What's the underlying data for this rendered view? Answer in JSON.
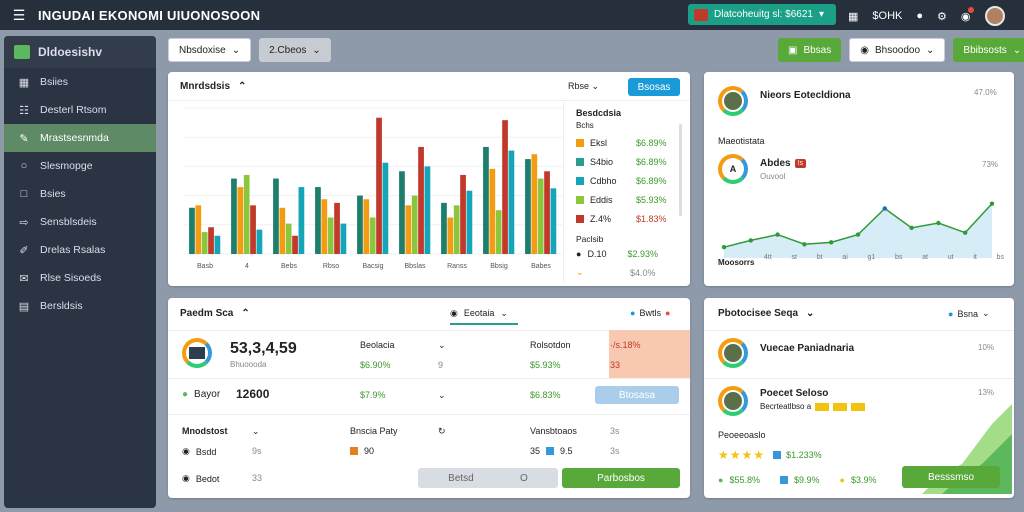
{
  "topbar": {
    "title": "INGUDAI EKONOMI UIUONOSOON",
    "chip_text": "Dlatcoheuitg sl: $6621",
    "icons": [
      "grid-icon",
      "bell-icon",
      "gear-icon",
      "notification-icon"
    ],
    "label": "$OHK"
  },
  "sidebar": {
    "title": "Dldoesishv",
    "items": [
      {
        "label": "Bsiies",
        "icon": "grid-icon"
      },
      {
        "label": "Desterl Rtsom",
        "icon": "chat-icon"
      },
      {
        "label": "Mrastsesnmda",
        "icon": "pencil-icon"
      },
      {
        "label": "Slesmopge",
        "icon": "search-icon"
      },
      {
        "label": "Bsies",
        "icon": "doc-icon"
      },
      {
        "label": "Sensblsdeis",
        "icon": "arrow-icon"
      },
      {
        "label": "Drelas Rsalas",
        "icon": "edit-icon"
      },
      {
        "label": "Rlse Sisoeds",
        "icon": "mail-icon"
      },
      {
        "label": "Bersldsis",
        "icon": "table-icon"
      }
    ],
    "active_index": 2
  },
  "filters": {
    "left1": "Nbsdoxise",
    "left2": "2.Cbeos",
    "right1": "Bbsas",
    "right2": "Bhsoodoo",
    "right3": "Bbibsosts"
  },
  "chart_card": {
    "title": "Mnrdsdsis",
    "dropdown": "Rbse",
    "button": "Bsosas",
    "legend_title": "Besdcdsia",
    "legend_sub": "Bchs",
    "legend": [
      {
        "label": "Eksl",
        "value": "$6.89%",
        "color": "#f39c12"
      },
      {
        "label": "S4bio",
        "value": "$6.89%",
        "color": "#2a9d8f"
      },
      {
        "label": "Cdbho",
        "value": "$6.89%",
        "color": "#16a5b8"
      },
      {
        "label": "Eddis",
        "value": "$5.93%",
        "color": "#8cc63f"
      },
      {
        "label": "Z.4%",
        "value": "$1.83%",
        "color": "#c0392b"
      }
    ],
    "legend_extra1": "Paclsib",
    "legend_extra2": "D.10",
    "legend_extra2_val": "$2.93%",
    "legend_extra3_val": "$4.0%"
  },
  "chart_data": {
    "type": "bar",
    "categories": [
      "Basb",
      "4",
      "Bebs",
      "Rbso",
      "Bacsig",
      "Bbslas",
      "Ranss",
      "Bbsig",
      "Babes"
    ],
    "series": [
      {
        "values": [
          38,
          62,
          62,
          55,
          48,
          68,
          42,
          88,
          78
        ],
        "color": "#1e7e6e"
      },
      {
        "values": [
          40,
          55,
          38,
          45,
          45,
          40,
          30,
          70,
          82
        ],
        "color": "#f39c12"
      },
      {
        "values": [
          18,
          65,
          25,
          30,
          30,
          48,
          40,
          36,
          62
        ],
        "color": "#8cc63f"
      },
      {
        "values": [
          22,
          40,
          15,
          42,
          112,
          88,
          65,
          110,
          68
        ],
        "color": "#c0392b"
      },
      {
        "values": [
          15,
          20,
          55,
          25,
          75,
          72,
          52,
          85,
          54
        ],
        "color": "#16a5b8"
      }
    ],
    "ylim": [
      0,
      120
    ]
  },
  "right_top": {
    "title": "Nieors Eotecldiona",
    "pct": "47.0%",
    "sub": "Maeotistata",
    "name": "Abdes",
    "badge": "!s",
    "pct2": "73%",
    "sub2": "Ouvool",
    "line_label": "Moosorrs",
    "line_data": {
      "type": "line",
      "values": [
        5,
        12,
        18,
        8,
        10,
        18,
        45,
        25,
        30,
        20,
        50
      ],
      "ylim": [
        0,
        60
      ]
    },
    "xticks": [
      "4tt",
      "st",
      "bt",
      "ai",
      "g1",
      "bs",
      "at",
      "ut",
      "it",
      "bs"
    ]
  },
  "perf_card": {
    "title": "Paedm Sca",
    "filter": "Eeotaia",
    "badge": "Bwtls",
    "big": "53,3,4,59",
    "big_sub": "Bhuoooda",
    "c1": "Beolacia",
    "c1v": "$6.90%",
    "c2": "Rolsotdon",
    "c2v": "$5.93%",
    "c3": "·/s.18%",
    "c3v": "33",
    "r2a": "Bayor",
    "r2b": "12600",
    "r2c": "$7.9%",
    "r2d": "$6.83%",
    "r2btn": "Btosasa",
    "r3a": "Mnodstost",
    "r3b": "Bnscia Paty",
    "r3c": "Vansbtoaos",
    "r3d": "3s",
    "r4a": "Bsdd",
    "r4b": "9s",
    "r4c": "90",
    "r4d": "35",
    "r4e": "9.5",
    "r4f": "3s",
    "r5a": "Bedot",
    "r5b": "33",
    "r5btn1": "Betsd",
    "r5btn1b": "O",
    "r5btn2": "Parbosbos"
  },
  "right_bottom": {
    "title": "Pbotocisee Seqa",
    "badge": "Bsna",
    "p1": "Vuecae Paniadnaria",
    "p1v": "10%",
    "p2": "Poecet Seloso",
    "p2sub": "Becrteatlbso a",
    "p2v": "13%",
    "label": "Peoeeoaslo",
    "rating": "$1.233%",
    "v1": "$55.8%",
    "v2": "$9.9%",
    "v3": "$3.9%",
    "button": "Besssmso"
  }
}
